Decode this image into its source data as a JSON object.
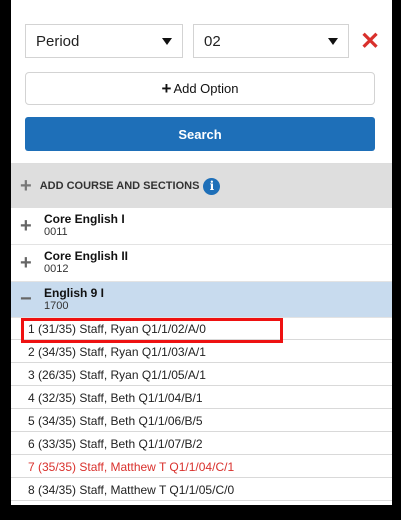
{
  "filter": {
    "field_value": "Period",
    "period_value": "02"
  },
  "add_option_label": "Add Option",
  "search_label": "Search",
  "add_course_label": "ADD COURSE AND SECTIONS",
  "courses": [
    {
      "name": "Core English I",
      "number": "0011",
      "toggle": "+"
    },
    {
      "name": "Core English II",
      "number": "0012",
      "toggle": "+"
    },
    {
      "name": "English 9 I",
      "number": "1700",
      "toggle": "−"
    }
  ],
  "sections": [
    {
      "text": "1 (31/35) Staff, Ryan  Q1/1/02/A/0"
    },
    {
      "text": "2 (34/35) Staff, Ryan  Q1/1/03/A/1"
    },
    {
      "text": "3 (26/35) Staff, Ryan  Q1/1/05/A/1"
    },
    {
      "text": "4 (32/35) Staff, Beth  Q1/1/04/B/1"
    },
    {
      "text": "5 (34/35) Staff, Beth  Q1/1/06/B/5"
    },
    {
      "text": "6 (33/35) Staff, Beth  Q1/1/07/B/2"
    },
    {
      "text": "7 (35/35) Staff, Matthew T  Q1/1/04/C/1"
    },
    {
      "text": "8 (34/35) Staff, Matthew T  Q1/1/05/C/0"
    }
  ],
  "colors": {
    "accent": "#1e6fb8",
    "full_section": "#d9302c",
    "selected_row": "#c8dbee"
  }
}
